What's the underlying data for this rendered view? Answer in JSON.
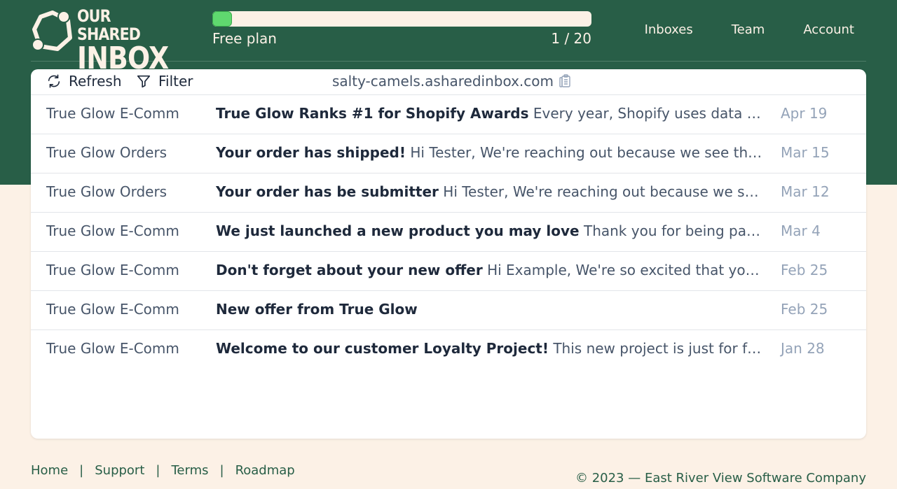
{
  "brand": {
    "line1": "OUR SHARED",
    "line2": "INBOX"
  },
  "plan": {
    "label": "Free plan",
    "count": "1 / 20",
    "used": 1,
    "limit": 20
  },
  "nav": {
    "items": [
      "Inboxes",
      "Team",
      "Account"
    ]
  },
  "toolbar": {
    "refresh_label": "Refresh",
    "filter_label": "Filter",
    "address": "salty-camels.asharedinbox.com"
  },
  "messages": [
    {
      "from": "True Glow E-Comm",
      "subject": "True Glow Ranks #1 for Shopify Awards",
      "preview": "Every year, Shopify uses data from their merchants to rank the best stores",
      "date": "Apr 19"
    },
    {
      "from": "True Glow Orders",
      "subject": "Your order has shipped!",
      "preview": "Hi Tester, We're reaching out because we see that you bought something",
      "date": "Mar 15"
    },
    {
      "from": "True Glow Orders",
      "subject": "Your order has be submitter",
      "preview": "Hi Tester, We're reaching out because we see that you bought something",
      "date": "Mar 12"
    },
    {
      "from": "True Glow E-Comm",
      "subject": "We just launched a new product you may love",
      "preview": "Thank you for being part project, we have something new",
      "date": "Mar 4"
    },
    {
      "from": "True Glow E-Comm",
      "subject": "Don't forget about your new offer",
      "preview": "Hi Example, We're so excited that you're ready to try it",
      "date": "Feb 25"
    },
    {
      "from": "True Glow E-Comm",
      "subject": "New offer from True Glow",
      "preview": "",
      "date": "Feb 25"
    },
    {
      "from": "True Glow E-Comm",
      "subject": "Welcome to our customer Loyalty Project!",
      "preview": "This new project is just for fans of our brand and products",
      "date": "Jan 28"
    }
  ],
  "footer": {
    "links": [
      "Home",
      "Support",
      "Terms",
      "Roadmap"
    ],
    "separator": "|",
    "copyright": "© 2023 — East River View Software Company"
  },
  "colors": {
    "brand_green": "#285e47",
    "cream": "#fcf1e6",
    "progress_green": "#5fd86f"
  }
}
